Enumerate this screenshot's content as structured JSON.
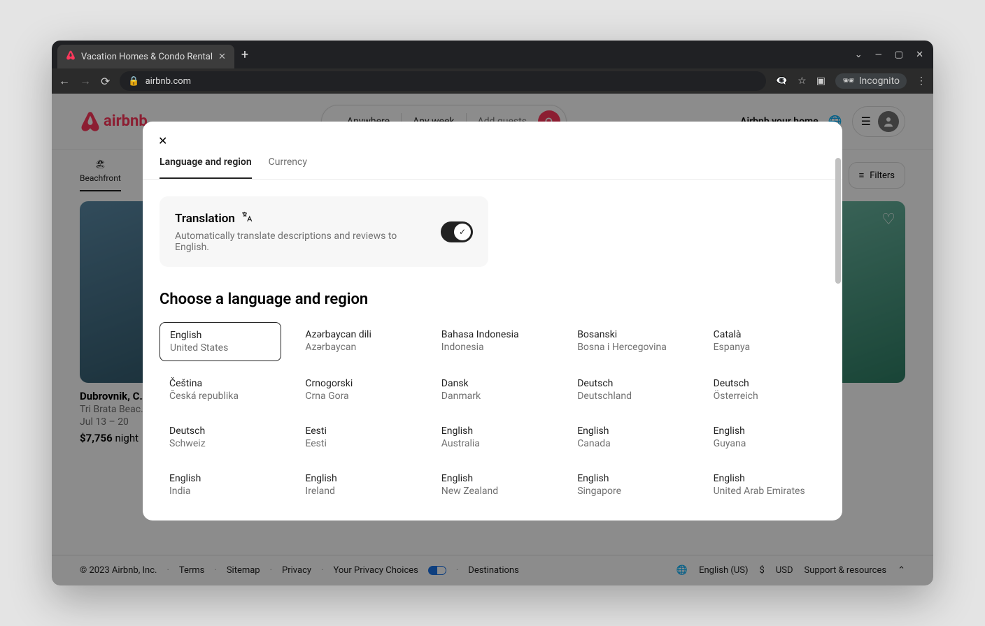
{
  "browser": {
    "tab_title": "Vacation Homes & Condo Rental",
    "url": "airbnb.com",
    "incognito_label": "Incognito"
  },
  "header": {
    "logo": "airbnb",
    "pill": {
      "anywhere": "Anywhere",
      "anyweek": "Any week",
      "addguests": "Add guests"
    },
    "host": "Airbnb your home"
  },
  "catbar": {
    "beachfront": "Beachfront",
    "filters": "Filters"
  },
  "listing": {
    "title": "Dubrovnik, C…",
    "beach": "Tri Brata Beac…",
    "dates": "Jul 13 – 20",
    "price": "$7,756",
    "per": "night"
  },
  "footer": {
    "copyright": "© 2023 Airbnb, Inc.",
    "terms": "Terms",
    "sitemap": "Sitemap",
    "privacy": "Privacy",
    "choices": "Your Privacy Choices",
    "destinations": "Destinations",
    "lang": "English (US)",
    "currency_sym": "$",
    "currency": "USD",
    "support": "Support & resources"
  },
  "modal": {
    "tabs": {
      "lang": "Language and region",
      "currency": "Currency"
    },
    "translate": {
      "title": "Translation",
      "desc": "Automatically translate descriptions and reviews to English."
    },
    "choose": "Choose a language and region",
    "languages": [
      {
        "l": "English",
        "r": "United States",
        "selected": true
      },
      {
        "l": "Azərbaycan dili",
        "r": "Azərbaycan"
      },
      {
        "l": "Bahasa Indonesia",
        "r": "Indonesia"
      },
      {
        "l": "Bosanski",
        "r": "Bosna i Hercegovina"
      },
      {
        "l": "Català",
        "r": "Espanya"
      },
      {
        "l": "Čeština",
        "r": "Česká republika"
      },
      {
        "l": "Crnogorski",
        "r": "Crna Gora"
      },
      {
        "l": "Dansk",
        "r": "Danmark"
      },
      {
        "l": "Deutsch",
        "r": "Deutschland"
      },
      {
        "l": "Deutsch",
        "r": "Österreich"
      },
      {
        "l": "Deutsch",
        "r": "Schweiz"
      },
      {
        "l": "Eesti",
        "r": "Eesti"
      },
      {
        "l": "English",
        "r": "Australia"
      },
      {
        "l": "English",
        "r": "Canada"
      },
      {
        "l": "English",
        "r": "Guyana"
      },
      {
        "l": "English",
        "r": "India"
      },
      {
        "l": "English",
        "r": "Ireland"
      },
      {
        "l": "English",
        "r": "New Zealand"
      },
      {
        "l": "English",
        "r": "Singapore"
      },
      {
        "l": "English",
        "r": "United Arab Emirates"
      }
    ]
  }
}
